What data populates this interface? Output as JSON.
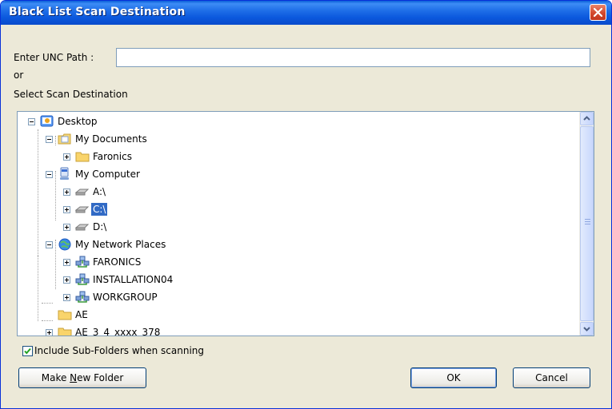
{
  "window": {
    "title": "Black List Scan Destination"
  },
  "form": {
    "unc_label": "Enter UNC Path :",
    "unc_value": "",
    "or_label": "or",
    "select_label": "Select Scan Destination"
  },
  "tree": {
    "nodes": [
      {
        "label": "Desktop",
        "icon": "desktop-icon",
        "expander": "minus"
      },
      {
        "label": "My Documents",
        "icon": "documents-folder-icon",
        "expander": "minus"
      },
      {
        "label": "Faronics",
        "icon": "folder-icon",
        "expander": "plus"
      },
      {
        "label": "My Computer",
        "icon": "computer-icon",
        "expander": "minus"
      },
      {
        "label": "A:\\",
        "icon": "drive-icon",
        "expander": "plus"
      },
      {
        "label": "C:\\",
        "icon": "drive-icon",
        "expander": "plus",
        "selected": true
      },
      {
        "label": "D:\\",
        "icon": "drive-icon",
        "expander": "plus"
      },
      {
        "label": "My Network Places",
        "icon": "network-places-icon",
        "expander": "minus"
      },
      {
        "label": "FARONICS",
        "icon": "workgroup-icon",
        "expander": "plus"
      },
      {
        "label": "INSTALLATION04",
        "icon": "workgroup-icon",
        "expander": "plus"
      },
      {
        "label": "WORKGROUP",
        "icon": "workgroup-icon",
        "expander": "plus"
      },
      {
        "label": "AE",
        "icon": "folder-icon",
        "expander": "none"
      },
      {
        "label": "AE_3_4_xxxx_378",
        "icon": "folder-icon",
        "expander": "plus"
      }
    ]
  },
  "options": {
    "include_subfolders_label": "Include Sub-Folders when scanning",
    "include_subfolders_checked": true
  },
  "buttons": {
    "make_new_folder_pre": "Make ",
    "make_new_folder_mnemonic": "N",
    "make_new_folder_post": "ew Folder",
    "ok": "OK",
    "cancel": "Cancel"
  },
  "colors": {
    "titlebar": "#0a58dd",
    "selection": "#316ac5",
    "dialog_bg": "#ece9d8",
    "close": "#d3482d"
  }
}
